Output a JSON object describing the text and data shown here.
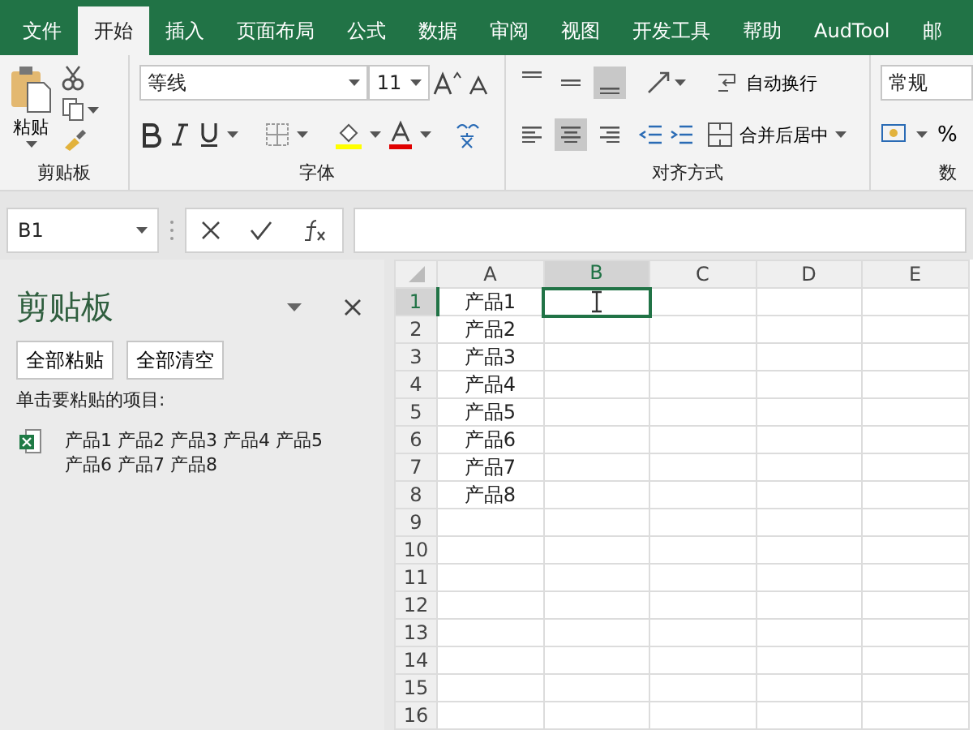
{
  "tabs": [
    {
      "label": "文件",
      "selected": false
    },
    {
      "label": "开始",
      "selected": true
    },
    {
      "label": "插入",
      "selected": false
    },
    {
      "label": "页面布局",
      "selected": false
    },
    {
      "label": "公式",
      "selected": false
    },
    {
      "label": "数据",
      "selected": false
    },
    {
      "label": "审阅",
      "selected": false
    },
    {
      "label": "视图",
      "selected": false
    },
    {
      "label": "开发工具",
      "selected": false
    },
    {
      "label": "帮助",
      "selected": false
    },
    {
      "label": "AudTool",
      "selected": false
    },
    {
      "label": "邮",
      "selected": false
    }
  ],
  "ribbon": {
    "clipboard": {
      "label": "剪贴板",
      "paste": "粘贴"
    },
    "font": {
      "label": "字体",
      "font_name": "等线",
      "font_size": "11"
    },
    "alignment": {
      "label": "对齐方式",
      "vertical": [
        {
          "kind": "top",
          "selected": false
        },
        {
          "kind": "middle",
          "selected": false
        },
        {
          "kind": "bottom",
          "selected": true
        }
      ],
      "horizontal": [
        {
          "kind": "left",
          "selected": false
        },
        {
          "kind": "center",
          "selected": true
        },
        {
          "kind": "right",
          "selected": false
        }
      ],
      "wrap_text": "自动换行",
      "merge_center": "合并后居中"
    },
    "number": {
      "label": "数",
      "format": "常规",
      "percent": "%"
    }
  },
  "formula_bar": {
    "name_box": "B1"
  },
  "clipboard_pane": {
    "title": "剪贴板",
    "buttons": [
      "全部粘贴",
      "全部清空"
    ],
    "instruction": "单击要粘贴的项目:",
    "items": [
      {
        "text": "产品1 产品2 产品3 产品4 产品5 产品6 产品7 产品8"
      }
    ]
  },
  "sheet": {
    "columns": [
      {
        "label": "A",
        "selected": false
      },
      {
        "label": "B",
        "selected": true
      },
      {
        "label": "C",
        "selected": false
      },
      {
        "label": "D",
        "selected": false
      },
      {
        "label": "E",
        "selected": false
      }
    ],
    "rows": [
      {
        "number": "1",
        "selected": true,
        "cells": [
          "产品1"
        ]
      },
      {
        "number": "2",
        "selected": false,
        "cells": [
          "产品2"
        ]
      },
      {
        "number": "3",
        "selected": false,
        "cells": [
          "产品3"
        ]
      },
      {
        "number": "4",
        "selected": false,
        "cells": [
          "产品4"
        ]
      },
      {
        "number": "5",
        "selected": false,
        "cells": [
          "产品5"
        ]
      },
      {
        "number": "6",
        "selected": false,
        "cells": [
          "产品6"
        ]
      },
      {
        "number": "7",
        "selected": false,
        "cells": [
          "产品7"
        ]
      },
      {
        "number": "8",
        "selected": false,
        "cells": [
          "产品8"
        ]
      },
      {
        "number": "9",
        "selected": false,
        "cells": []
      },
      {
        "number": "10",
        "selected": false,
        "cells": []
      },
      {
        "number": "11",
        "selected": false,
        "cells": []
      },
      {
        "number": "12",
        "selected": false,
        "cells": []
      },
      {
        "number": "13",
        "selected": false,
        "cells": []
      },
      {
        "number": "14",
        "selected": false,
        "cells": []
      },
      {
        "number": "15",
        "selected": false,
        "cells": []
      },
      {
        "number": "16",
        "selected": false,
        "cells": []
      }
    ]
  }
}
